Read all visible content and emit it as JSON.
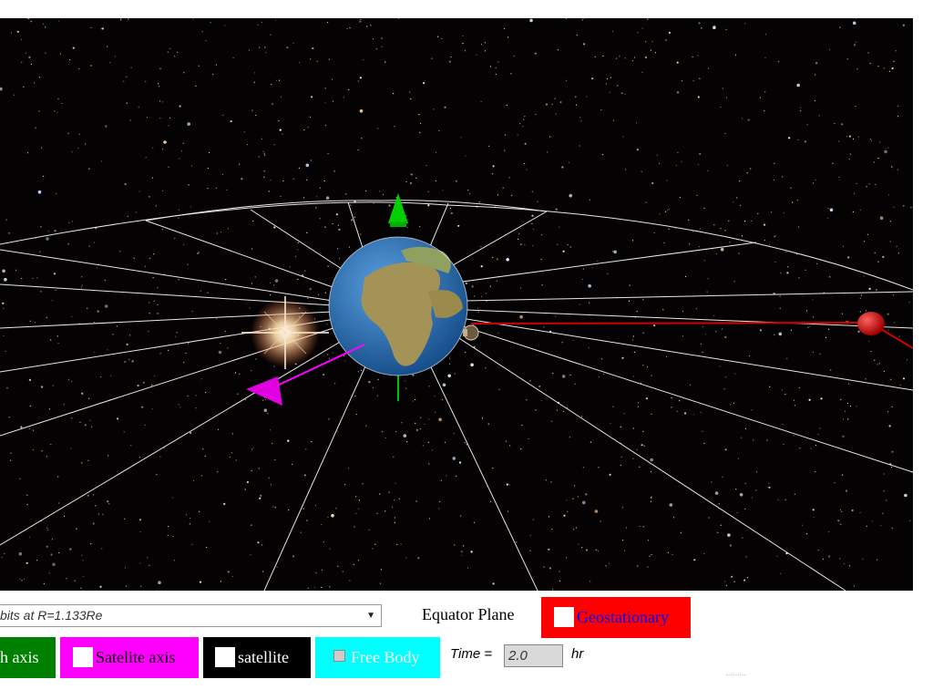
{
  "colors": {
    "space": "#050204",
    "orbit_lines": "#ffffff",
    "earth_axis": "#00c000",
    "satellite_axis": "#ff00ff",
    "geostationary": "#ff0000",
    "ocean": "#1f6fb0",
    "land": "#9b8a4f"
  },
  "icons": {
    "earth": "earth-globe-icon",
    "sun": "sun-flare-icon",
    "satellite": "satellite-icon",
    "geostationary_satellite": "red-sphere-icon"
  },
  "controls": {
    "orbit_select": {
      "value": "bits at R=1.133Re"
    },
    "equator_label": "Equator Plane",
    "geostationary_label": "Geostationary",
    "earth_axis_label": "h axis",
    "satellite_axis_label": "Satelite axis",
    "satellite_label": "satellite",
    "free_body_label": "Free Body",
    "time_label": "Time =",
    "time_value": "2.0",
    "time_unit": "hr"
  }
}
